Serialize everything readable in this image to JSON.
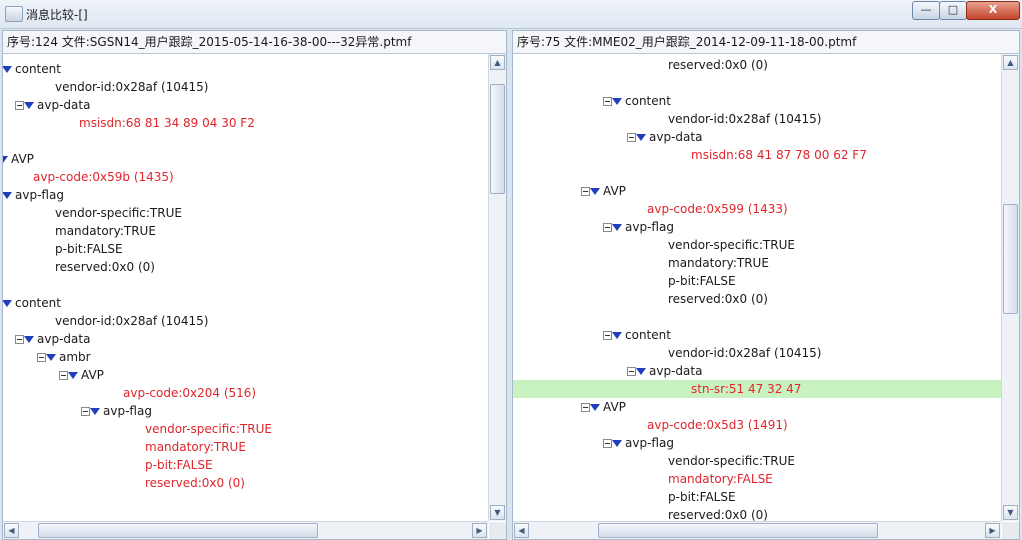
{
  "window": {
    "title": "消息比较-[]",
    "buttons": {
      "minimize": "—",
      "maximize": "□",
      "close": "X"
    }
  },
  "left_pane": {
    "header": "序号:124 文件:SGSN14_用户跟踪_2015-05-14-16-38-00---32异常.ptmf",
    "rows": [
      {
        "label": "content",
        "indent": 12,
        "toggle": true,
        "tri": true
      },
      {
        "label": "vendor-id:0x28af (10415)",
        "indent": 52
      },
      {
        "label": "avp-data",
        "indent": 34,
        "toggle": true,
        "tri": true
      },
      {
        "label": "msisdn:68 81 34 89 04 30 F2",
        "indent": 76,
        "red": true
      },
      {
        "label": "",
        "indent": 0
      },
      {
        "label": "AVP",
        "indent": 8,
        "tri": true
      },
      {
        "label": "avp-code:0x59b (1435)",
        "indent": 30,
        "red": true
      },
      {
        "label": "avp-flag",
        "indent": 12,
        "toggle": true,
        "tri": true
      },
      {
        "label": "vendor-specific:TRUE",
        "indent": 52
      },
      {
        "label": "mandatory:TRUE",
        "indent": 52
      },
      {
        "label": "p-bit:FALSE",
        "indent": 52
      },
      {
        "label": "reserved:0x0 (0)",
        "indent": 52
      },
      {
        "label": "",
        "indent": 0
      },
      {
        "label": "content",
        "indent": 12,
        "toggle": true,
        "tri": true
      },
      {
        "label": "vendor-id:0x28af (10415)",
        "indent": 52
      },
      {
        "label": "avp-data",
        "indent": 34,
        "toggle": true,
        "tri": true
      },
      {
        "label": "ambr",
        "indent": 56,
        "toggle": true,
        "tri": true
      },
      {
        "label": "AVP",
        "indent": 78,
        "toggle": true,
        "tri": true
      },
      {
        "label": "avp-code:0x204 (516)",
        "indent": 120,
        "red": true
      },
      {
        "label": "avp-flag",
        "indent": 100,
        "toggle": true,
        "tri": true
      },
      {
        "label": "vendor-specific:TRUE",
        "indent": 142,
        "red": true
      },
      {
        "label": "mandatory:TRUE",
        "indent": 142,
        "red": true
      },
      {
        "label": "p-bit:FALSE",
        "indent": 142,
        "red": true
      },
      {
        "label": "reserved:0x0 (0)",
        "indent": 142,
        "red": true
      }
    ]
  },
  "right_pane": {
    "header": "序号:75 文件:MME02_用户跟踪_2014-12-09-11-18-00.ptmf",
    "rows": [
      {
        "label": "reserved:0x0 (0)",
        "indent": 155
      },
      {
        "label": "",
        "indent": 0
      },
      {
        "label": "content",
        "indent": 112,
        "toggle": true,
        "tri": true
      },
      {
        "label": "vendor-id:0x28af (10415)",
        "indent": 155
      },
      {
        "label": "avp-data",
        "indent": 136,
        "toggle": true,
        "tri": true
      },
      {
        "label": "msisdn:68 41 87 78 00 62 F7",
        "indent": 178,
        "red": true
      },
      {
        "label": "",
        "indent": 0
      },
      {
        "label": "AVP",
        "indent": 90,
        "toggle": true,
        "tri": true
      },
      {
        "label": "avp-code:0x599 (1433)",
        "indent": 134,
        "red": true
      },
      {
        "label": "avp-flag",
        "indent": 112,
        "toggle": true,
        "tri": true
      },
      {
        "label": "vendor-specific:TRUE",
        "indent": 155
      },
      {
        "label": "mandatory:TRUE",
        "indent": 155
      },
      {
        "label": "p-bit:FALSE",
        "indent": 155
      },
      {
        "label": "reserved:0x0 (0)",
        "indent": 155
      },
      {
        "label": "",
        "indent": 0
      },
      {
        "label": "content",
        "indent": 112,
        "toggle": true,
        "tri": true
      },
      {
        "label": "vendor-id:0x28af (10415)",
        "indent": 155
      },
      {
        "label": "avp-data",
        "indent": 136,
        "toggle": true,
        "tri": true
      },
      {
        "label": "stn-sr:51 47 32 47",
        "indent": 178,
        "red": true,
        "highlight": true
      },
      {
        "label": "AVP",
        "indent": 90,
        "toggle": true,
        "tri": true
      },
      {
        "label": "avp-code:0x5d3 (1491)",
        "indent": 134,
        "red": true
      },
      {
        "label": "avp-flag",
        "indent": 112,
        "toggle": true,
        "tri": true
      },
      {
        "label": "vendor-specific:TRUE",
        "indent": 155
      },
      {
        "label": "mandatory:FALSE",
        "indent": 155,
        "red": true
      },
      {
        "label": "p-bit:FALSE",
        "indent": 155
      },
      {
        "label": "reserved:0x0 (0)",
        "indent": 155
      }
    ]
  }
}
